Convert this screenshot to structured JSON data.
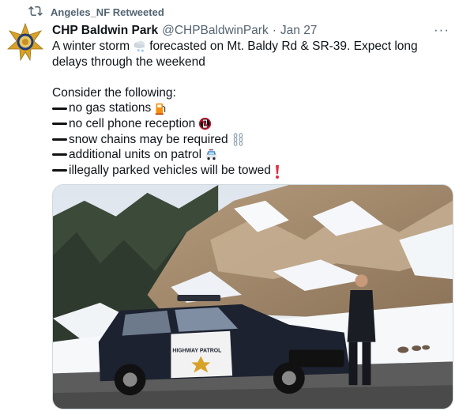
{
  "retweet": {
    "label": "Angeles_NF Retweeted",
    "icon": "retweet-icon"
  },
  "tweet": {
    "author_name": "CHP Baldwin Park",
    "handle": "@CHPBaldwinPark",
    "separator": "·",
    "date": "Jan 27",
    "more_label": "···",
    "text": {
      "line1_a": "A winter storm",
      "line1_b": "forecasted on Mt. Baldy Rd & SR-39. Expect long",
      "line2": "delays through the weekend",
      "line4": "Consider the following:",
      "items": [
        {
          "text": "no gas stations",
          "emoji": "fuel-pump-icon"
        },
        {
          "text": "no cell phone reception",
          "emoji": "no-mobile-phones-icon"
        },
        {
          "text": "snow chains may be required",
          "emoji": "chains-icon"
        },
        {
          "text": "additional units on patrol",
          "emoji": "police-car-icon"
        },
        {
          "text": "illegally parked vehicles will be towed",
          "emoji": "exclamation-icon"
        }
      ],
      "storm_emoji": "cloud-snow-icon"
    },
    "avatar_icon": "chp-star-badge-icon",
    "media": {
      "car_door_text": "HIGHWAY PATROL"
    }
  },
  "colors": {
    "text_primary": "#0f1419",
    "text_secondary": "#536471",
    "border": "#cfd9de",
    "badge_gold": "#d7a227",
    "badge_blue": "#1f3a7a"
  }
}
